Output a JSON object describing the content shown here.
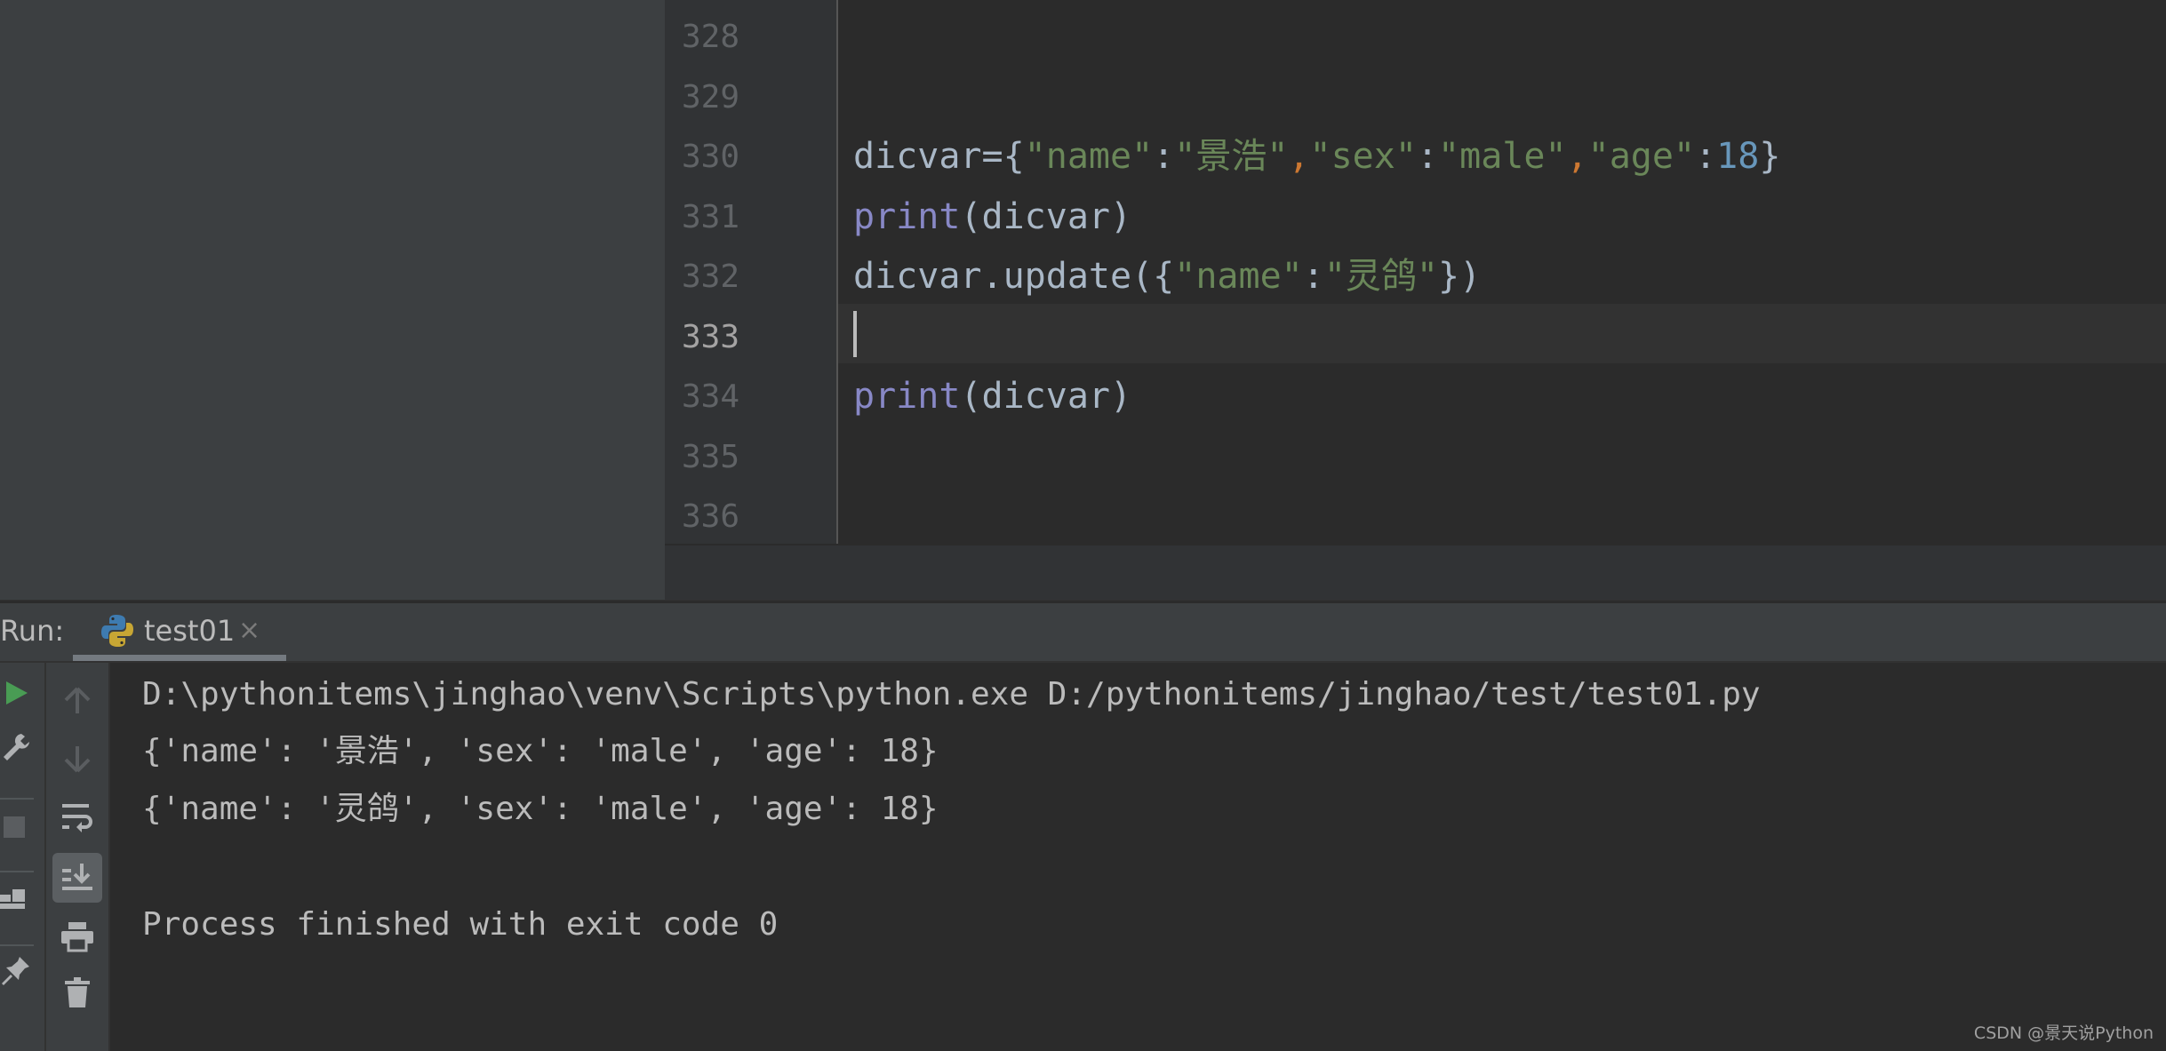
{
  "editor": {
    "lines": [
      {
        "number": "328",
        "tokens": []
      },
      {
        "number": "329",
        "tokens": []
      },
      {
        "number": "330",
        "tokens": [
          {
            "t": "dicvar={",
            "c": ""
          },
          {
            "t": "\"name\"",
            "c": "str"
          },
          {
            "t": ":",
            "c": ""
          },
          {
            "t": "\"景浩\"",
            "c": "str"
          },
          {
            "t": ",",
            "c": "comma"
          },
          {
            "t": "\"sex\"",
            "c": "str"
          },
          {
            "t": ":",
            "c": ""
          },
          {
            "t": "\"male\"",
            "c": "str"
          },
          {
            "t": ",",
            "c": "comma"
          },
          {
            "t": "\"age\"",
            "c": "str"
          },
          {
            "t": ":",
            "c": ""
          },
          {
            "t": "18",
            "c": "num"
          },
          {
            "t": "}",
            "c": ""
          }
        ]
      },
      {
        "number": "331",
        "tokens": [
          {
            "t": "print",
            "c": "kw"
          },
          {
            "t": "(dicvar)",
            "c": ""
          }
        ]
      },
      {
        "number": "332",
        "tokens": [
          {
            "t": "dicvar.update({",
            "c": ""
          },
          {
            "t": "\"name\"",
            "c": "str"
          },
          {
            "t": ":",
            "c": ""
          },
          {
            "t": "\"灵鸽\"",
            "c": "str"
          },
          {
            "t": "})",
            "c": ""
          }
        ]
      },
      {
        "number": "333",
        "tokens": [],
        "current": true
      },
      {
        "number": "334",
        "tokens": [
          {
            "t": "print",
            "c": "kw"
          },
          {
            "t": "(dicvar)",
            "c": ""
          }
        ]
      },
      {
        "number": "335",
        "tokens": []
      },
      {
        "number": "336",
        "tokens": []
      }
    ]
  },
  "run_panel": {
    "label": "Run:",
    "tab": {
      "label": "test01",
      "icon": "python-icon",
      "close": "×"
    },
    "toolbar_left": [
      "run-icon",
      "wrench-icon",
      "stop-icon",
      "layout-icon",
      "pin-icon"
    ],
    "toolbar_right": [
      "arrow-up-icon",
      "arrow-down-icon",
      "soft-wrap-icon",
      "scroll-to-end-icon",
      "print-icon",
      "trash-icon"
    ],
    "console_lines": [
      "D:\\pythonitems\\jinghao\\venv\\Scripts\\python.exe D:/pythonitems/jinghao/test/test01.py",
      "{'name': '景浩', 'sex': 'male', 'age': 18}",
      "{'name': '灵鸽', 'sex': 'male', 'age': 18}",
      "",
      "Process finished with exit code 0"
    ]
  },
  "watermark": "CSDN @景天说Python"
}
